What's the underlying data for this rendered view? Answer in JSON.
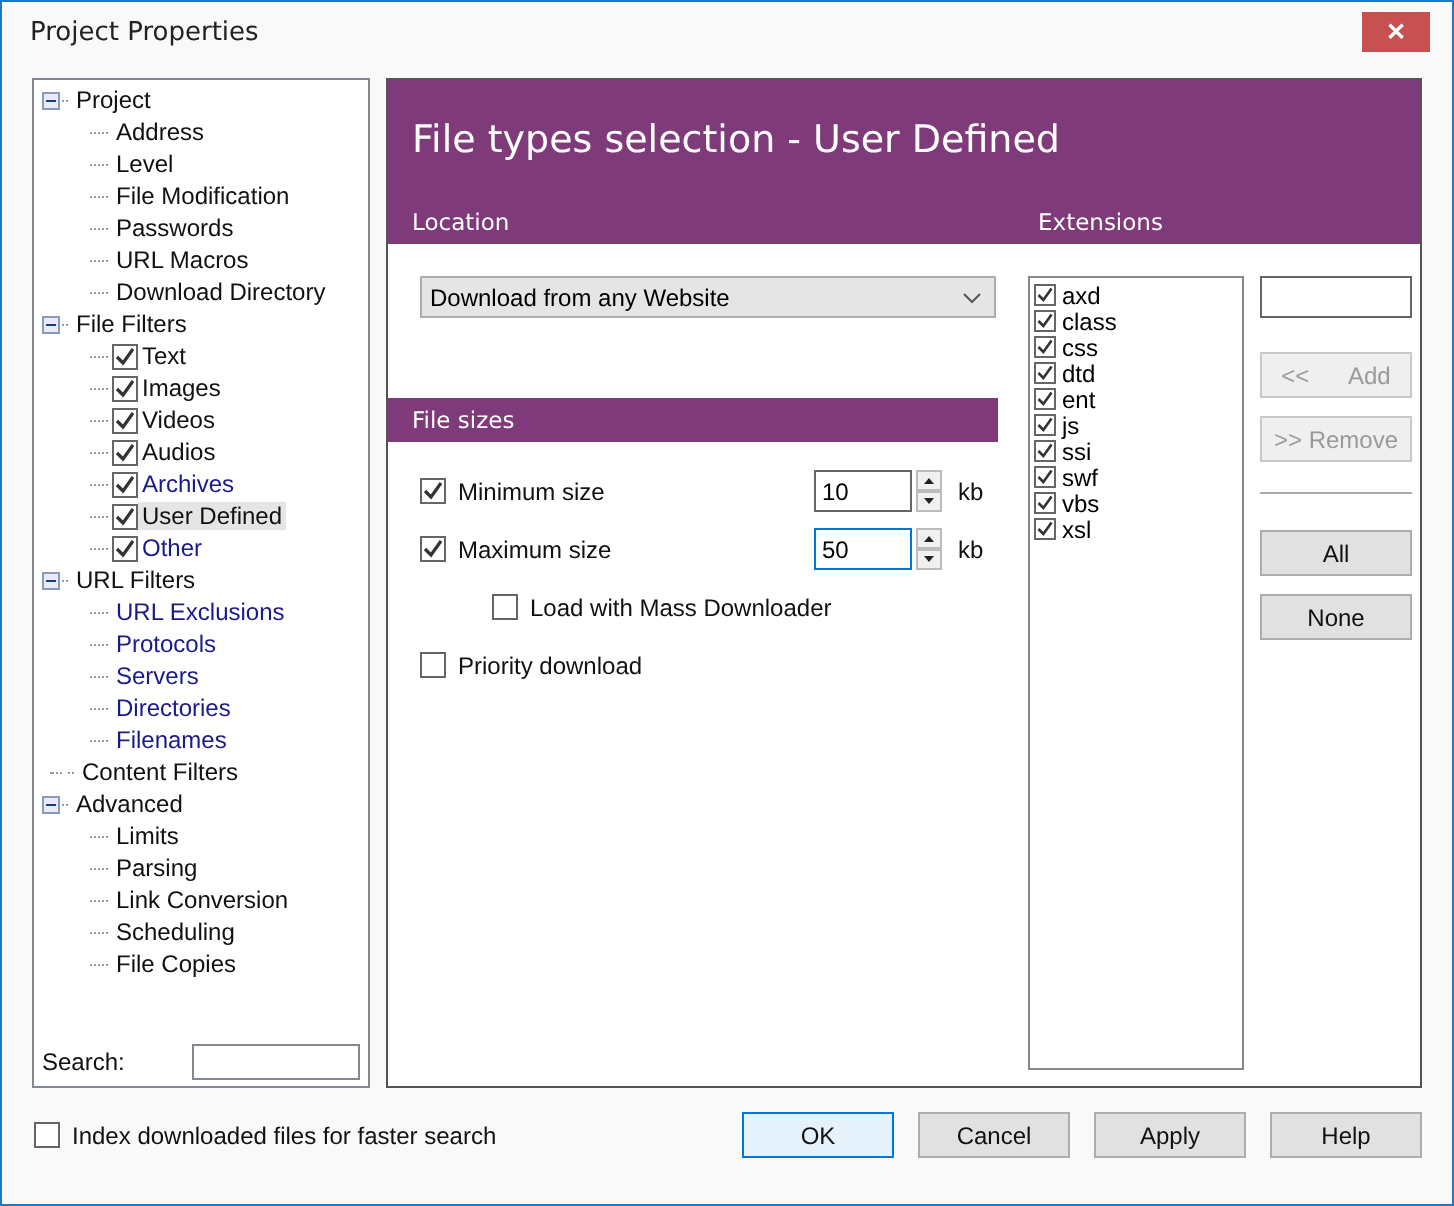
{
  "window": {
    "title": "Project Properties",
    "close": "✕"
  },
  "tree": [
    {
      "label": "Project",
      "expanded": true,
      "children": [
        {
          "label": "Address",
          "linked": false,
          "selected": false
        },
        {
          "label": "Level",
          "linked": false,
          "selected": false
        },
        {
          "label": "File Modification",
          "linked": false,
          "selected": false
        },
        {
          "label": "Passwords",
          "linked": false,
          "selected": false
        },
        {
          "label": "URL Macros",
          "linked": false,
          "selected": false
        },
        {
          "label": "Download Directory",
          "linked": false,
          "selected": false
        }
      ]
    },
    {
      "label": "File Filters",
      "expanded": true,
      "children": [
        {
          "label": "Text",
          "checked": true,
          "linked": false,
          "selected": false
        },
        {
          "label": "Images",
          "checked": true,
          "linked": false,
          "selected": false
        },
        {
          "label": "Videos",
          "checked": true,
          "linked": false,
          "selected": false
        },
        {
          "label": "Audios",
          "checked": true,
          "linked": false,
          "selected": false
        },
        {
          "label": "Archives",
          "checked": true,
          "linked": true,
          "selected": false
        },
        {
          "label": "User Defined",
          "checked": true,
          "linked": false,
          "selected": true
        },
        {
          "label": "Other",
          "checked": true,
          "linked": true,
          "selected": false
        }
      ]
    },
    {
      "label": "URL Filters",
      "expanded": true,
      "children": [
        {
          "label": "URL Exclusions",
          "linked": true,
          "selected": false
        },
        {
          "label": "Protocols",
          "linked": true,
          "selected": false
        },
        {
          "label": "Servers",
          "linked": true,
          "selected": false
        },
        {
          "label": "Directories",
          "linked": true,
          "selected": false
        },
        {
          "label": "Filenames",
          "linked": true,
          "selected": false
        }
      ]
    },
    {
      "label": "Content Filters"
    },
    {
      "label": "Advanced",
      "expanded": true,
      "children": [
        {
          "label": "Limits",
          "linked": false,
          "selected": false
        },
        {
          "label": "Parsing",
          "linked": false,
          "selected": false
        },
        {
          "label": "Link Conversion",
          "linked": false,
          "selected": false
        },
        {
          "label": "Scheduling",
          "linked": false,
          "selected": false
        },
        {
          "label": "File Copies",
          "linked": false,
          "selected": false
        }
      ]
    }
  ],
  "search": {
    "label": "Search:"
  },
  "panel": {
    "title": "File types selection - User Defined",
    "location_header": "Location",
    "extensions_header": "Extensions",
    "location": "Download from any Website",
    "file_sizes_header": "File sizes",
    "sizes": [
      {
        "label": "Minimum size",
        "checked": true,
        "value": "10",
        "unit": "kb",
        "focused": false
      },
      {
        "label": "Maximum size",
        "checked": true,
        "value": "50",
        "unit": "kb",
        "focused": true
      }
    ],
    "mass_downloader": {
      "label": "Load with Mass Downloader",
      "checked": false
    },
    "priority": {
      "label": "Priority download",
      "checked": false
    },
    "extensions": [
      {
        "label": "axd",
        "checked": true
      },
      {
        "label": "class",
        "checked": true
      },
      {
        "label": "css",
        "checked": true
      },
      {
        "label": "dtd",
        "checked": true
      },
      {
        "label": "ent",
        "checked": true
      },
      {
        "label": "js",
        "checked": true
      },
      {
        "label": "ssi",
        "checked": true
      },
      {
        "label": "swf",
        "checked": true
      },
      {
        "label": "vbs",
        "checked": true
      },
      {
        "label": "xsl",
        "checked": true
      }
    ],
    "ext_buttons": [
      {
        "label": "<<      Add",
        "disabled": true
      },
      {
        "label": ">> Remove",
        "disabled": true
      }
    ],
    "select_buttons": [
      {
        "label": "All",
        "disabled": false
      },
      {
        "label": "None",
        "disabled": false
      }
    ]
  },
  "index_option": {
    "label": "Index downloaded files for faster search",
    "checked": false
  },
  "buttons": [
    {
      "label": "OK",
      "default": true
    },
    {
      "label": "Cancel",
      "default": false
    },
    {
      "label": "Apply",
      "default": false
    },
    {
      "label": "Help",
      "default": false
    }
  ]
}
